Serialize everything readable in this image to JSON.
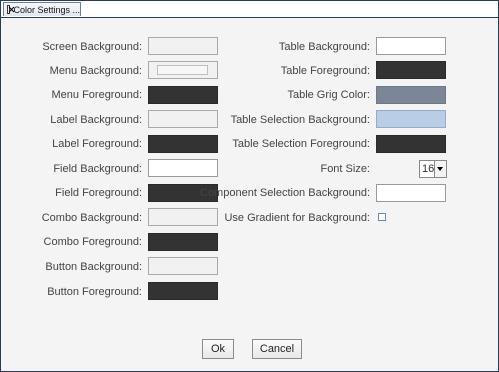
{
  "window": {
    "tab_title": "Color Settings ..."
  },
  "left": {
    "screen_bg": "Screen Background:",
    "menu_bg": "Menu Background:",
    "menu_fg": "Menu Foreground:",
    "label_bg": "Label Background:",
    "label_fg": "Label Foreground:",
    "field_bg": "Field Background:",
    "field_fg": "Field Foreground:",
    "combo_bg": "Combo Background:",
    "combo_fg": "Combo Foreground:",
    "button_bg": "Button Background:",
    "button_fg": "Button Foreground:"
  },
  "right": {
    "table_bg": "Table Background:",
    "table_fg": "Table Foreground:",
    "table_grid": "Table Grig Color:",
    "table_sel_bg": "Table Selection Background:",
    "table_sel_fg": "Table Selection Foreground:",
    "font_size_label": "Font Size:",
    "font_size_value": "16",
    "component_sel_bg": "Component Selection Background:",
    "use_gradient": "Use Gradient for Background:"
  },
  "colors": {
    "light": "#f1f1f1",
    "dark": "#333333",
    "white": "#ffffff",
    "grid": "#7b8797",
    "selection": "#b9cde6"
  },
  "buttons": {
    "ok": "Ok",
    "cancel": "Cancel"
  }
}
